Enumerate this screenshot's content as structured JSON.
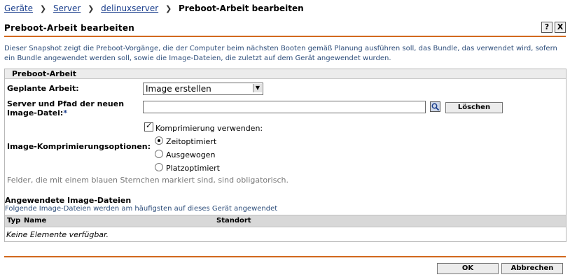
{
  "breadcrumb": {
    "items": [
      "Geräte",
      "Server",
      "delinuxserver"
    ],
    "current": "Preboot-Arbeit bearbeiten"
  },
  "title": "Preboot-Arbeit bearbeiten",
  "title_buttons": {
    "help": "?",
    "close": "X"
  },
  "description": "Dieser Snapshot zeigt die Preboot-Vorgänge, die der Computer beim nächsten Booten gemäß Planung ausführen soll, das Bundle, das verwendet wird, sofern ein Bundle angewendet werden soll, sowie die Image-Dateien, die zuletzt auf dem Gerät angewendet wurden.",
  "section": {
    "title": "Preboot-Arbeit",
    "scheduled_label": "Geplante Arbeit:",
    "scheduled_value": "Image erstellen",
    "server_label_line1": "Server und Pfad der neuen",
    "server_label_line2": "Image-Datei:",
    "required_mark": "*",
    "server_value": "",
    "clear_button": "Löschen",
    "compression_label": "Image-Komprimierungsoptionen:",
    "use_compression_label": "Komprimierung verwenden:",
    "use_compression_checked": true,
    "options": [
      {
        "label": "Zeitoptimiert",
        "selected": true
      },
      {
        "label": "Ausgewogen",
        "selected": false
      },
      {
        "label": "Platzoptimiert",
        "selected": false
      }
    ],
    "note": "Felder, die mit einem blauen Sternchen markiert sind, sind obligatorisch."
  },
  "applied": {
    "title": "Angewendete Image-Dateien",
    "subtitle": "Folgende Image-Dateien werden am häufigsten auf dieses Gerät angewendet",
    "columns": [
      "Typ",
      "Name",
      "Standort"
    ],
    "empty_text": "Keine Elemente verfügbar."
  },
  "footer": {
    "ok": "OK",
    "cancel": "Abbrechen"
  },
  "colors": {
    "accent_rule": "#d2691e",
    "link": "#1a3e8c",
    "required": "#1a3e8c"
  }
}
